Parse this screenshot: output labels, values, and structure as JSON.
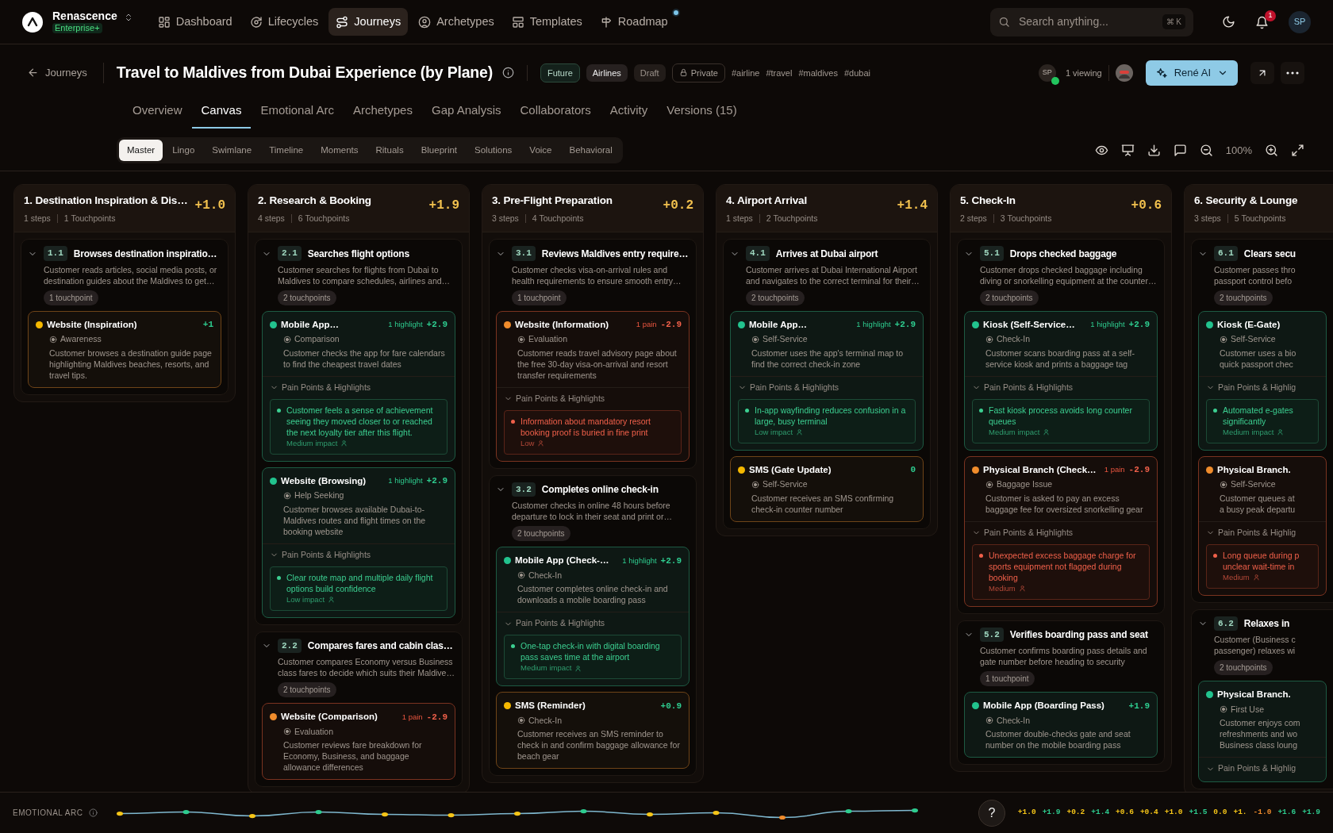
{
  "brand": {
    "name": "Renascence",
    "plan": "Enterprise+"
  },
  "nav": [
    {
      "label": "Dashboard",
      "selected": false,
      "new": false
    },
    {
      "label": "Lifecycles",
      "selected": false,
      "new": false
    },
    {
      "label": "Journeys",
      "selected": true,
      "new": false
    },
    {
      "label": "Archetypes",
      "selected": false,
      "new": false
    },
    {
      "label": "Templates",
      "selected": false,
      "new": false
    },
    {
      "label": "Roadmap",
      "selected": false,
      "new": true
    }
  ],
  "search": {
    "placeholder": "Search anything...",
    "shortcut": "⌘ K"
  },
  "notifications": {
    "count": "1"
  },
  "user": {
    "initials": "SP"
  },
  "header": {
    "back": "Journeys",
    "title": "Travel to Maldives from Dubai Experience (by Plane)",
    "tags": [
      {
        "label": "Future",
        "kind": "status"
      },
      {
        "label": "Airlines",
        "kind": "category"
      },
      {
        "label": "Draft",
        "kind": "state"
      },
      {
        "label": "Private",
        "kind": "privacy"
      }
    ],
    "hashtags": [
      "#airline",
      "#travel",
      "#maldives",
      "#dubai"
    ],
    "viewer": {
      "initials": "SP",
      "online": true
    },
    "viewing": "1 viewing",
    "ai_button": "René AI"
  },
  "tabs": [
    {
      "label": "Overview",
      "selected": false
    },
    {
      "label": "Canvas",
      "selected": true
    },
    {
      "label": "Emotional Arc",
      "selected": false
    },
    {
      "label": "Archetypes",
      "selected": false
    },
    {
      "label": "Gap Analysis",
      "selected": false
    },
    {
      "label": "Collaborators",
      "selected": false
    },
    {
      "label": "Activity",
      "selected": false
    },
    {
      "label": "Versions (15)",
      "selected": false
    }
  ],
  "views": [
    {
      "label": "Master",
      "selected": true
    },
    {
      "label": "Lingo",
      "selected": false
    },
    {
      "label": "Swimlane",
      "selected": false
    },
    {
      "label": "Timeline",
      "selected": false
    },
    {
      "label": "Moments",
      "selected": false
    },
    {
      "label": "Rituals",
      "selected": false
    },
    {
      "label": "Blueprint",
      "selected": false
    },
    {
      "label": "Solutions",
      "selected": false
    },
    {
      "label": "Voice",
      "selected": false
    },
    {
      "label": "Behavioral",
      "selected": false
    }
  ],
  "zoom": "100%",
  "stages": [
    {
      "title": "1. Destination Inspiration & Dis…",
      "steps": "1 steps",
      "touchpoints": "1 Touchpoints",
      "score": "+1.0",
      "items": [
        {
          "number": "1.1",
          "title": "Browses destination inspiratio…",
          "expanded": true,
          "desc": "Customer reads articles, social media posts, or destination guides about the Maldives to get…",
          "count": "1 touchpoint",
          "touchpoints": [
            {
              "name": "Website (Inspiration)",
              "kind": "neutral",
              "score": "+1",
              "stage": "Awareness",
              "desc": "Customer browses a destination guide page highlighting Maldives beaches, resorts, and travel tips."
            }
          ]
        }
      ]
    },
    {
      "title": "2. Research & Booking",
      "steps": "4 steps",
      "touchpoints": "6 Touchpoints",
      "score": "+1.9",
      "items": [
        {
          "number": "2.1",
          "title": "Searches flight options",
          "expanded": true,
          "desc": "Customer searches for flights from Dubai to Maldives to compare schedules, airlines and…",
          "count": "2 touchpoints",
          "touchpoints": [
            {
              "name": "Mobile App…",
              "kind": "positive",
              "badge": "1 highlight",
              "score": "+2.9",
              "stage": "Comparison",
              "desc": "Customer checks the app for fare calendars to find the cheapest travel dates",
              "section": "Pain Points & Highlights",
              "findings": [
                {
                  "kind": "highlight",
                  "text": "Customer feels a sense of achievement seeing they moved closer to or reached the next loyalty tier after this flight.",
                  "impact": "Medium impact"
                }
              ]
            },
            {
              "name": "Website (Browsing)",
              "kind": "positive",
              "badge": "1 highlight",
              "score": "+2.9",
              "stage": "Help Seeking",
              "desc": "Customer browses available Dubai-to-Maldives routes and flight times on the booking website",
              "section": "Pain Points & Highlights",
              "findings": [
                {
                  "kind": "highlight",
                  "text": "Clear route map and multiple daily flight options build confidence",
                  "impact": "Low impact"
                }
              ]
            }
          ]
        },
        {
          "number": "2.2",
          "title": "Compares fares and cabin clas…",
          "expanded": true,
          "desc": "Customer compares Economy versus Business class fares to decide which suits their Maldive…",
          "count": "2 touchpoints",
          "touchpoints": [
            {
              "name": "Website (Comparison)",
              "kind": "negative",
              "badge": "1 pain",
              "score": "-2.9",
              "stage": "Evaluation",
              "desc": "Customer reviews fare breakdown for Economy, Business, and baggage allowance differences"
            }
          ]
        }
      ]
    },
    {
      "title": "3. Pre-Flight Preparation",
      "steps": "3 steps",
      "touchpoints": "4 Touchpoints",
      "score": "+0.2",
      "items": [
        {
          "number": "3.1",
          "title": "Reviews Maldives entry require…",
          "expanded": true,
          "desc": "Customer checks visa-on-arrival rules and health requirements to ensure smooth entry…",
          "count": "1 touchpoint",
          "touchpoints": [
            {
              "name": "Website (Information)",
              "kind": "negative",
              "badge": "1 pain",
              "score": "-2.9",
              "stage": "Evaluation",
              "desc": "Customer reads travel advisory page about the free 30-day visa-on-arrival and resort transfer requirements",
              "section": "Pain Points & Highlights",
              "findings": [
                {
                  "kind": "pain",
                  "text": "Information about mandatory resort booking proof is buried in fine print",
                  "impact": "Low"
                }
              ]
            }
          ]
        },
        {
          "number": "3.2",
          "title": "Completes online check-in",
          "expanded": true,
          "desc": "Customer checks in online 48 hours before departure to lock in their seat and print or…",
          "count": "2 touchpoints",
          "touchpoints": [
            {
              "name": "Mobile App (Check-…",
              "kind": "positive",
              "badge": "1 highlight",
              "score": "+2.9",
              "stage": "Check-In",
              "desc": "Customer completes online check-in and downloads a mobile boarding pass",
              "section": "Pain Points & Highlights",
              "findings": [
                {
                  "kind": "highlight",
                  "text": "One-tap check-in with digital boarding pass saves time at the airport",
                  "impact": "Medium impact"
                }
              ]
            },
            {
              "name": "SMS (Reminder)",
              "kind": "neutral",
              "score": "+0.9",
              "stage": "Check-In",
              "desc": "Customer receives an SMS reminder to check in and confirm baggage allowance for beach gear"
            }
          ]
        }
      ]
    },
    {
      "title": "4. Airport Arrival",
      "steps": "1 steps",
      "touchpoints": "2 Touchpoints",
      "score": "+1.4",
      "items": [
        {
          "number": "4.1",
          "title": "Arrives at Dubai airport",
          "expanded": true,
          "desc": "Customer arrives at Dubai International Airport and navigates to the correct terminal for their…",
          "count": "2 touchpoints",
          "touchpoints": [
            {
              "name": "Mobile App…",
              "kind": "positive",
              "badge": "1 highlight",
              "score": "+2.9",
              "stage": "Self-Service",
              "desc": "Customer uses the app's terminal map to find the correct check-in zone",
              "section": "Pain Points & Highlights",
              "findings": [
                {
                  "kind": "highlight",
                  "text": "In-app wayfinding reduces confusion in a large, busy terminal",
                  "impact": "Low impact"
                }
              ]
            },
            {
              "name": "SMS (Gate Update)",
              "kind": "neutral",
              "score": "0",
              "stage": "Self-Service",
              "desc": "Customer receives an SMS confirming check-in counter number"
            }
          ]
        }
      ]
    },
    {
      "title": "5. Check-In",
      "steps": "2 steps",
      "touchpoints": "3 Touchpoints",
      "score": "+0.6",
      "items": [
        {
          "number": "5.1",
          "title": "Drops checked baggage",
          "expanded": true,
          "desc": "Customer drops checked baggage including diving or snorkelling equipment at the counter…",
          "count": "2 touchpoints",
          "touchpoints": [
            {
              "name": "Kiosk (Self-Service…",
              "kind": "positive",
              "badge": "1 highlight",
              "score": "+2.9",
              "stage": "Check-In",
              "desc": "Customer scans boarding pass at a self-service kiosk and prints a baggage tag",
              "section": "Pain Points & Highlights",
              "findings": [
                {
                  "kind": "highlight",
                  "text": "Fast kiosk process avoids long counter queues",
                  "impact": "Medium impact"
                }
              ]
            },
            {
              "name": "Physical Branch (Check…",
              "kind": "negative",
              "badge": "1 pain",
              "score": "-2.9",
              "stage": "Baggage Issue",
              "desc": "Customer is asked to pay an excess baggage fee for oversized snorkelling gear",
              "section": "Pain Points & Highlights",
              "findings": [
                {
                  "kind": "pain",
                  "text": "Unexpected excess baggage charge for sports equipment not flagged during booking",
                  "impact": "Medium"
                }
              ]
            }
          ]
        },
        {
          "number": "5.2",
          "title": "Verifies boarding pass and seat",
          "expanded": true,
          "desc": "Customer confirms boarding pass details and gate number before heading to security",
          "count": "1 touchpoint",
          "touchpoints": [
            {
              "name": "Mobile App (Boarding Pass)",
              "kind": "positive",
              "score": "+1.9",
              "stage": "Check-In",
              "desc": "Customer double-checks gate and seat number on the mobile boarding pass"
            }
          ]
        }
      ]
    },
    {
      "title": "6. Security & Lounge",
      "steps": "3 steps",
      "touchpoints": "5 Touchpoints",
      "items": [
        {
          "number": "6.1",
          "title": "Clears secu",
          "expanded": true,
          "desc": "Customer passes thro\npassport control befo",
          "count": "2 touchpoints",
          "touchpoints": [
            {
              "name": "Kiosk (E-Gate)",
              "kind": "positive",
              "stage": "Self-Service",
              "desc": "Customer uses a bio\nquick passport chec",
              "section": "Pain Points & Highlig",
              "findings": [
                {
                  "kind": "highlight",
                  "text": "Automated e-gates\nsignificantly",
                  "impact": "Medium impact"
                }
              ]
            },
            {
              "name": "Physical Branch.",
              "kind": "negative",
              "stage": "Self-Service",
              "desc": "Customer queues at\na busy peak departu",
              "section": "Pain Points & Highlig",
              "findings": [
                {
                  "kind": "pain",
                  "text": "Long queue during p\nunclear wait-time in",
                  "impact": "Medium"
                }
              ]
            }
          ]
        },
        {
          "number": "6.2",
          "title": "Relaxes in",
          "expanded": true,
          "desc": "Customer (Business c\npassenger) relaxes wi",
          "count": "2 touchpoints",
          "touchpoints": [
            {
              "name": "Physical Branch.",
              "kind": "positive",
              "stage": "First Use",
              "desc": "Customer enjoys com\nrefreshments and wo\nBusiness class loung",
              "section": "Pain Points & Highlig"
            }
          ]
        }
      ]
    }
  ],
  "arc": {
    "label": "EMOTIONAL ARC",
    "help": "?",
    "values": [
      {
        "text": "+1.0",
        "color": "#f5c518"
      },
      {
        "text": "+1.9",
        "color": "#2ecc8f"
      },
      {
        "text": "+0.2",
        "color": "#f5c518"
      },
      {
        "text": "+1.4",
        "color": "#2ecc8f"
      },
      {
        "text": "+0.6",
        "color": "#f5c518"
      },
      {
        "text": "+0.4",
        "color": "#f5c518"
      },
      {
        "text": "+1.0",
        "color": "#f5c518"
      },
      {
        "text": "+1.5",
        "color": "#2ecc8f"
      },
      {
        "text": "0.0",
        "color": "#f5c518"
      },
      {
        "text": "+1.",
        "color": "#f5c518"
      },
      {
        "text": "-1.0",
        "color": "#f08c2c"
      },
      {
        "text": "+1.6",
        "color": "#2ecc8f"
      },
      {
        "text": "+1.9",
        "color": "#2ecc8f"
      }
    ]
  }
}
